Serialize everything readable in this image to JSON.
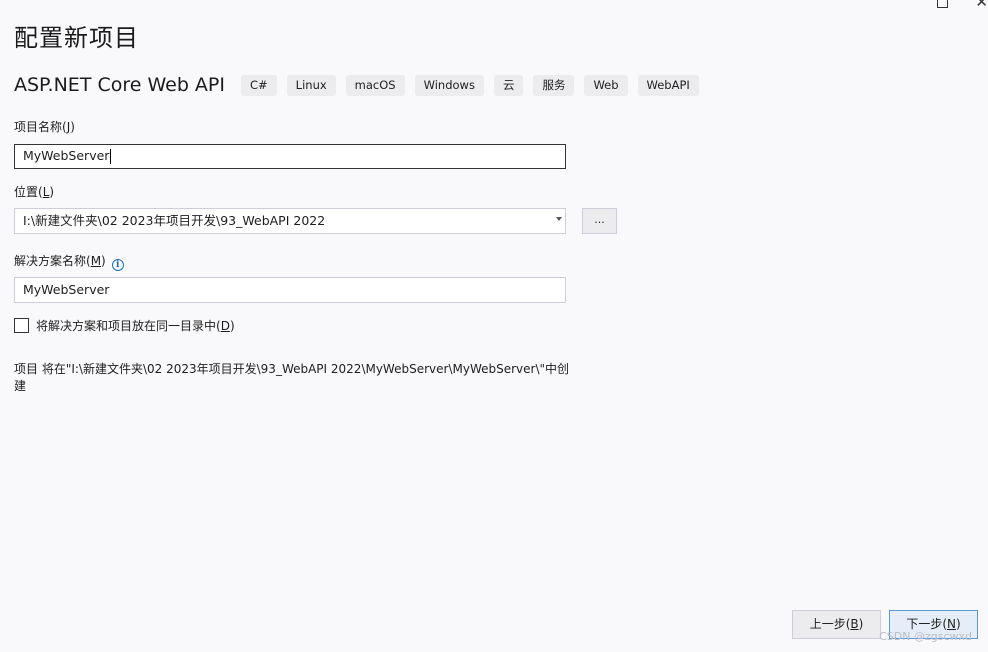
{
  "window": {
    "minimize_glyph": "—",
    "close_glyph": "✕"
  },
  "page": {
    "title": "配置新项目"
  },
  "template": {
    "name": "ASP.NET Core Web API",
    "tags": [
      "C#",
      "Linux",
      "macOS",
      "Windows",
      "云",
      "服务",
      "Web",
      "WebAPI"
    ]
  },
  "project_name": {
    "label": "项目名称(",
    "accel": "J",
    "label_end": ")",
    "value": "MyWebServer"
  },
  "location": {
    "label": "位置(",
    "accel": "L",
    "label_end": ")",
    "value": "I:\\新建文件夹\\02 2023年项目开发\\93_WebAPI 2022",
    "browse_label": "..."
  },
  "solution_name": {
    "label": "解决方案名称(",
    "accel": "M",
    "label_end": ")",
    "value": "MyWebServer",
    "info_glyph": "i"
  },
  "same_dir": {
    "label": "将解决方案和项目放在同一目录中(",
    "accel": "D",
    "label_end": ")",
    "checked": false
  },
  "summary": {
    "text": "项目 将在\"I:\\新建文件夹\\02 2023年项目开发\\93_WebAPI 2022\\MyWebServer\\MyWebServer\\\"中创建"
  },
  "footer": {
    "back_label": "上一步(",
    "back_accel": "B",
    "next_label": "下一步(",
    "next_accel": "N",
    "label_end": ")"
  },
  "watermark": {
    "text": "CSDN @zgscwxd"
  },
  "colors": {
    "background": "#f9f9fb",
    "accent": "#1e6fc1",
    "tag_bg": "#ececee"
  }
}
